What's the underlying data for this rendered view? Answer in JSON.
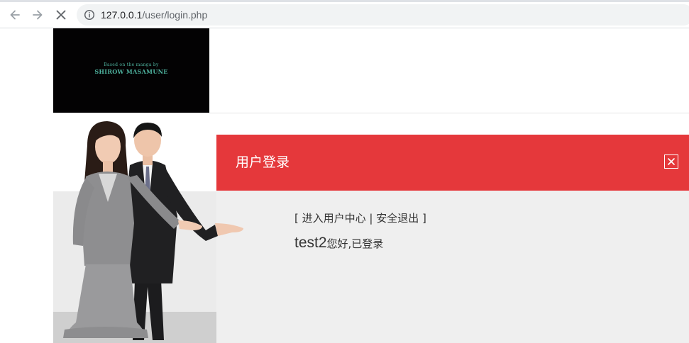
{
  "browser": {
    "url_host": "127.0.0.1",
    "url_path": "/user/login.php"
  },
  "banner": {
    "caption_line1": "Based on the manga by",
    "caption_line2": "SHIROW MASAMUNE"
  },
  "login_panel": {
    "title": "用户登录",
    "open_bracket": "[ ",
    "user_center_link": "进入用户中心",
    "separator": " | ",
    "logout_link": "安全退出",
    "close_bracket": " ]",
    "username": "test2",
    "welcome_message": "您好,已登录"
  },
  "colors": {
    "header_red": "#e5383b",
    "panel_bg": "#efefef"
  }
}
